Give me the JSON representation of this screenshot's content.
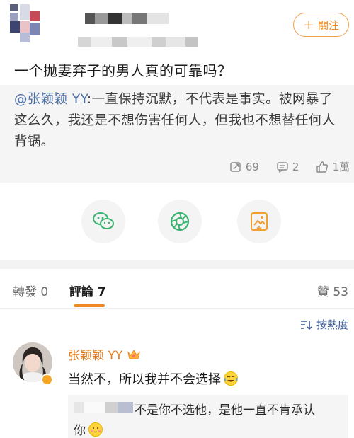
{
  "post": {
    "follow_label": "關注",
    "title": "一个抛妻弃子的男人真的可靠吗？",
    "quote_mention": "@张颖颖 YY",
    "quote_body": ":一直保持沉默，不代表是事实。被网暴了这么久，我还是不想伤害任何人，但我也不想替任何人背锅。",
    "stats": {
      "reposts": "69",
      "comments": "2",
      "likes": "1萬"
    }
  },
  "share": {
    "icons": [
      "wechat-icon",
      "moments-icon",
      "save-image-icon"
    ]
  },
  "tabs": {
    "repost": "轉發 0",
    "comments": "評論 7",
    "likes": "贊 53"
  },
  "sort": {
    "label": "按熱度"
  },
  "comment": {
    "author": "张颖颖 YY",
    "text": "当然不，所以我并不会选择",
    "reply_text": "不是你不选他，是他一直不肯承认",
    "reply_text_end": "你"
  },
  "colors": {
    "accent": "#f08a24",
    "mention": "#4a6fa5",
    "link": "#3b5998"
  }
}
